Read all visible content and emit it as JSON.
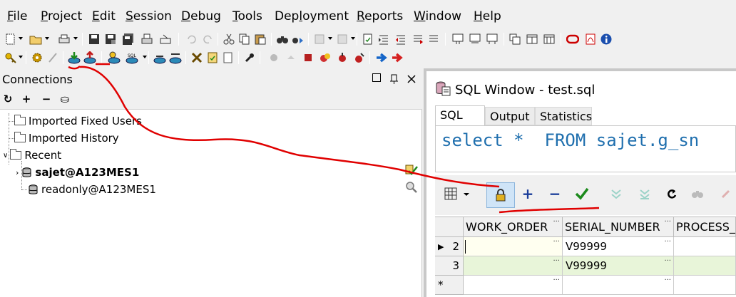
{
  "menu": [
    {
      "pre": "",
      "ul": "F",
      "post": "ile"
    },
    {
      "pre": "",
      "ul": "P",
      "post": "roject"
    },
    {
      "pre": "",
      "ul": "E",
      "post": "dit"
    },
    {
      "pre": "",
      "ul": "S",
      "post": "ession"
    },
    {
      "pre": "",
      "ul": "D",
      "post": "ebug"
    },
    {
      "pre": "",
      "ul": "T",
      "post": "ools"
    },
    {
      "pre": "Dep",
      "ul": "l",
      "post": "oyment"
    },
    {
      "pre": "",
      "ul": "R",
      "post": "eports"
    },
    {
      "pre": "",
      "ul": "W",
      "post": "indow"
    },
    {
      "pre": "",
      "ul": "H",
      "post": "elp"
    }
  ],
  "connections": {
    "title": "Connections",
    "tools": [
      "↻",
      "+",
      "−",
      "⛀"
    ],
    "tree": {
      "fixed_users": "Imported Fixed Users",
      "history": "Imported History",
      "recent": "Recent",
      "conn1": "sajet@A123MES1",
      "conn2": "readonly@A123MES1"
    }
  },
  "sql_window": {
    "title": "SQL Window - test.sql",
    "tabs": [
      "SQL",
      "Output",
      "Statistics"
    ],
    "active_tab": "SQL",
    "query": "select *  FROM sajet.g_sn"
  },
  "result_grid": {
    "columns": [
      "WORK_ORDER",
      "SERIAL_NUMBER",
      "PROCESS_"
    ],
    "rows": [
      {
        "index": "2",
        "work_order": "",
        "serial_number": "V99999",
        "process": ""
      },
      {
        "index": "3",
        "work_order": "",
        "serial_number": "V99999",
        "process": ""
      },
      {
        "index": "*",
        "work_order": "",
        "serial_number": "",
        "process": ""
      }
    ]
  },
  "colors": {
    "sql_keyword": "#1f6fae",
    "annotation": "#e00000",
    "row_highlight": "#e8f5d9",
    "cell_current": "#fffff0"
  }
}
